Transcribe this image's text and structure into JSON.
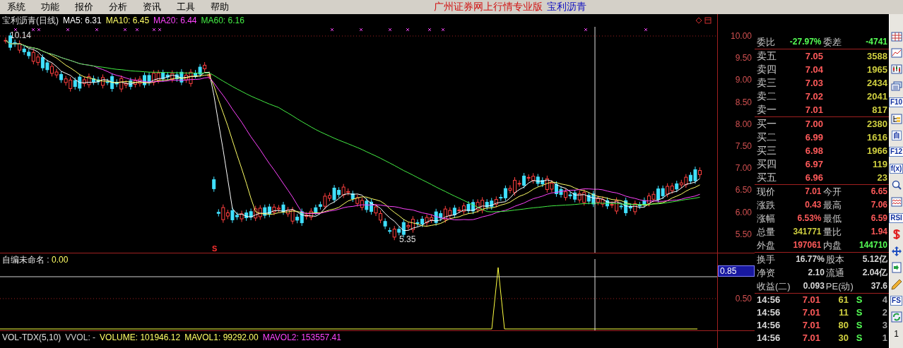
{
  "menu": [
    "系统",
    "功能",
    "报价",
    "分析",
    "资讯",
    "工具",
    "帮助"
  ],
  "title": {
    "app": "广州证券网上行情专业版",
    "stock": "宝利沥青"
  },
  "chart": {
    "name": "宝利沥青(日线)",
    "ma": [
      {
        "label": "MA5:",
        "value": "6.31",
        "color": "#ffffff"
      },
      {
        "label": "MA10:",
        "value": "6.45",
        "color": "#ffff66"
      },
      {
        "label": "MA20:",
        "value": "6.44",
        "color": "#ff44ff"
      },
      {
        "label": "MA60:",
        "value": "6.16",
        "color": "#44ee44"
      }
    ],
    "high_label": "10.14",
    "low_label": "5.35",
    "signal_label": "S",
    "y_labels": [
      "10.00",
      "9.50",
      "9.00",
      "8.50",
      "8.00",
      "7.50",
      "7.00",
      "6.50",
      "6.00",
      "5.50"
    ]
  },
  "indicator": {
    "name": "自编未命名",
    "separator": ":",
    "value": "0.00",
    "y_labels": [
      {
        "text": "0.85",
        "selected": true
      },
      {
        "text": "0.50",
        "selected": false
      }
    ]
  },
  "volume": {
    "name": "VOL-TDX(5,10)",
    "items": [
      {
        "label": "VVOL:",
        "value": "-",
        "color": "#d0d0d0"
      },
      {
        "label": "VOLUME:",
        "value": "101946.12",
        "color": "#ffff66"
      },
      {
        "label": "MAVOL1:",
        "value": "99292.00",
        "color": "#ffff66"
      },
      {
        "label": "MAVOL2:",
        "value": "153557.41",
        "color": "#ff44ff"
      }
    ]
  },
  "quote": {
    "weibi": {
      "label": "委比",
      "value": "-27.97%",
      "label2": "委差",
      "value2": "-4741"
    },
    "asks": [
      {
        "label": "卖五",
        "price": "7.05",
        "volume": "3588"
      },
      {
        "label": "卖四",
        "price": "7.04",
        "volume": "1965"
      },
      {
        "label": "卖三",
        "price": "7.03",
        "volume": "2434"
      },
      {
        "label": "卖二",
        "price": "7.02",
        "volume": "2041"
      },
      {
        "label": "卖一",
        "price": "7.01",
        "volume": "817"
      }
    ],
    "bids": [
      {
        "label": "买一",
        "price": "7.00",
        "volume": "2380"
      },
      {
        "label": "买二",
        "price": "6.99",
        "volume": "1616"
      },
      {
        "label": "买三",
        "price": "6.98",
        "volume": "1966"
      },
      {
        "label": "买四",
        "price": "6.97",
        "volume": "119"
      },
      {
        "label": "买五",
        "price": "6.96",
        "volume": "23"
      }
    ],
    "stats": [
      [
        {
          "label": "现价",
          "value": "7.01",
          "color": "#ff5a5a"
        },
        {
          "label": "今开",
          "value": "6.65",
          "color": "#ff5a5a"
        }
      ],
      [
        {
          "label": "涨跌",
          "value": "0.43",
          "color": "#ff5a5a"
        },
        {
          "label": "最高",
          "value": "7.06",
          "color": "#ff5a5a"
        }
      ],
      [
        {
          "label": "涨幅",
          "value": "6.53%",
          "color": "#ff5a5a"
        },
        {
          "label": "最低",
          "value": "6.59",
          "color": "#ff5a5a"
        }
      ],
      [
        {
          "label": "总量",
          "value": "341771",
          "color": "#d0d040"
        },
        {
          "label": "量比",
          "value": "1.94",
          "color": "#ff5a5a"
        }
      ],
      [
        {
          "label": "外盘",
          "value": "197061",
          "color": "#ff5a5a"
        },
        {
          "label": "内盘",
          "value": "144710",
          "color": "#55ff55"
        }
      ]
    ],
    "finance": [
      {
        "label": "换手",
        "value": "16.77%",
        "label2": "股本",
        "value2": "5.12亿"
      },
      {
        "label": "净资",
        "value": "2.10",
        "label2": "流通",
        "value2": "2.04亿"
      },
      {
        "label": "收益(二)",
        "value": "0.093",
        "label2": "PE(动)",
        "value2": "37.6"
      }
    ],
    "trades": [
      {
        "time": "14:56",
        "price": "7.01",
        "volume": "61",
        "side": "S",
        "count": "4"
      },
      {
        "time": "14:56",
        "price": "7.01",
        "volume": "11",
        "side": "S",
        "count": "2"
      },
      {
        "time": "14:56",
        "price": "7.01",
        "volume": "80",
        "side": "S",
        "count": "3"
      },
      {
        "time": "14:56",
        "price": "7.01",
        "volume": "30",
        "side": "S",
        "count": "1"
      }
    ]
  },
  "toolbar": [
    {
      "kind": "grid"
    },
    {
      "kind": "line"
    },
    {
      "kind": "candles"
    },
    {
      "kind": "windows"
    },
    {
      "kind": "text",
      "label": "F10"
    },
    {
      "kind": "tree"
    },
    {
      "kind": "text",
      "label": "自"
    },
    {
      "kind": "text",
      "label": "F12"
    },
    {
      "kind": "text",
      "label": "f(x)"
    },
    {
      "kind": "magnifier"
    },
    {
      "kind": "wave"
    },
    {
      "kind": "text",
      "label": "RSI"
    },
    {
      "kind": "dollar"
    },
    {
      "kind": "move"
    },
    {
      "kind": "enter"
    },
    {
      "kind": "pencil"
    },
    {
      "kind": "text",
      "label": "FS"
    },
    {
      "kind": "refresh"
    },
    {
      "kind": "text",
      "label": "1"
    }
  ]
}
